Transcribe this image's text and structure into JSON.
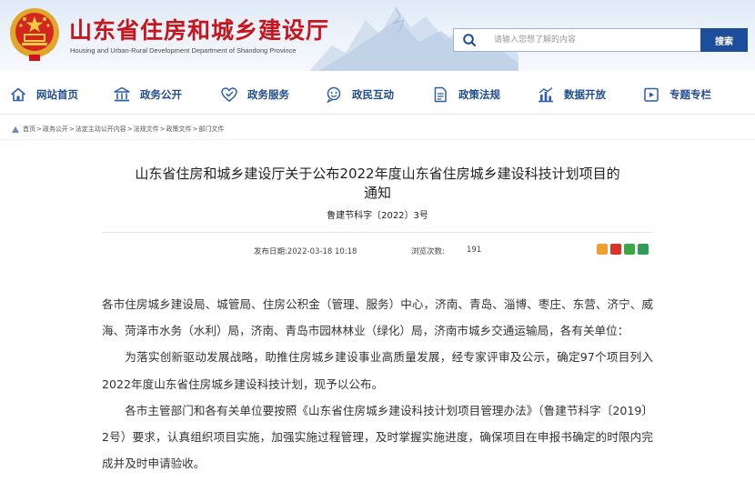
{
  "header": {
    "title": "山东省住房和城乡建设厅",
    "subtitle": "Housing and Urban-Rural Development Department of Shandong Province",
    "search_placeholder": "请输入您想了解的内容",
    "search_button": "搜索"
  },
  "nav": {
    "items": [
      {
        "label": "网站首页",
        "icon": "home-icon"
      },
      {
        "label": "政务公开",
        "icon": "building-icon"
      },
      {
        "label": "政务服务",
        "icon": "service-icon"
      },
      {
        "label": "政民互动",
        "icon": "interaction-icon"
      },
      {
        "label": "政策法规",
        "icon": "document-icon"
      },
      {
        "label": "数据开放",
        "icon": "chart-icon"
      },
      {
        "label": "专题专栏",
        "icon": "folder-icon"
      }
    ]
  },
  "breadcrumb": {
    "items": [
      "首页",
      "政务公开",
      "法定主动公开内容",
      "法规文件",
      "政策文件",
      "部门文件"
    ],
    "separator": ">"
  },
  "article": {
    "title_line1": "山东省住房和城乡建设厅关于公布2022年度山东省住房城乡建设科技计划项目的",
    "title_line2": "通知",
    "doc_number": "鲁建节科字〔2022〕3号",
    "publish_label": "发布日期:2022-03-18 10:18",
    "views_label": "浏览次数:",
    "views_count": "191",
    "paragraphs": [
      "各市住房城乡建设局、城管局、住房公积金（管理、服务）中心，济南、青岛、淄博、枣庄、东营、济宁、威海、菏泽市水务（水利）局，济南、青岛市园林林业（绿化）局，济南市城乡交通运输局，各有关单位：",
      "为落实创新驱动发展战略，助推住房城乡建设事业高质量发展，经专家评审及公示，确定97个项目列入2022年度山东省住房城乡建设科技计划，现予以公布。",
      "各市主管部门和各有关单位要按照《山东省住房城乡建设科技计划项目管理办法》（鲁建节科字〔2019〕2号）要求，认真组织项目实施，加强实施过程管理，及时掌握实施进度，确保项目在申报书确定的时限内完成并及时申请验收。"
    ]
  },
  "colors": {
    "title_red": "#c8141c",
    "nav_blue": "#1f4d8f",
    "search_blue": "#1d4e9c"
  }
}
